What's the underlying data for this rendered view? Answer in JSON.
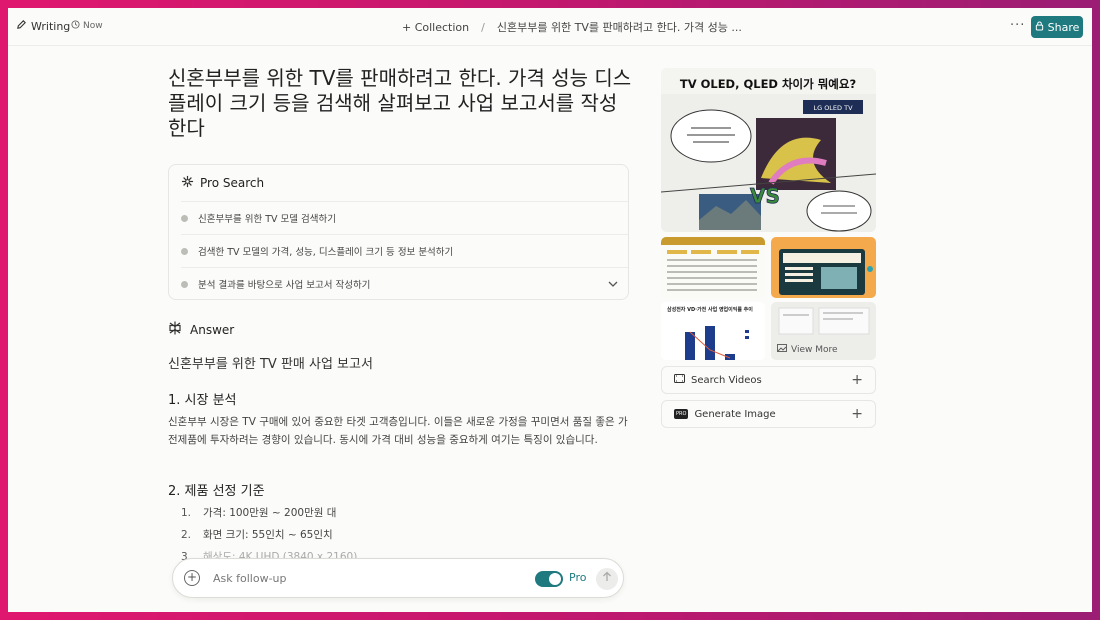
{
  "topbar": {
    "writing_label": "Writing",
    "time_label": "Now",
    "collection_label": "+ Collection",
    "breadcrumb_separator": "/",
    "thread_title": "신혼부부를 위한 TV를 판매하려고 한다. 가격 성능 ...",
    "more_label": "···",
    "share_label": "Share"
  },
  "main": {
    "title": "신혼부부를 위한 TV를 판매하려고 한다. 가격 성능 디스플레이 크기 등을 검색해 살펴보고 사업 보고서를 작성한다",
    "pro_search": {
      "label": "Pro Search",
      "steps": [
        "신혼부부를 위한 TV 모델 검색하기",
        "검색한 TV 모델의 가격, 성능, 디스플레이 크기 등 정보 분석하기",
        "분석 결과를 바탕으로 사업 보고서 작성하기"
      ]
    },
    "answer": {
      "label": "Answer",
      "report_title": "신혼부부를 위한 TV 판매 사업 보고서",
      "section1_heading": "1. 시장 분석",
      "section1_body": "신혼부부 시장은 TV 구매에 있어 중요한 타겟 고객층입니다. 이들은 새로운 가정을 꾸미면서 품질 좋은 가전제품에 투자하려는 경향이 있습니다. 동시에 가격 대비 성능을 중요하게 여기는 특징이 있습니다.",
      "section2_heading": "2. 제품 선정 기준",
      "criteria": [
        {
          "num": "1.",
          "text": "가격: 100만원 ~ 200만원 대"
        },
        {
          "num": "2.",
          "text": "화면 크기: 55인치 ~ 65인치"
        },
        {
          "num": "3.",
          "text": "해상도: 4K UHD (3840 x 2160)"
        }
      ]
    }
  },
  "followup": {
    "placeholder": "Ask follow-up",
    "pro_label": "Pro"
  },
  "sidebar": {
    "image_main_text": "TV OLED, QLED 차이가 뭐예요?",
    "image_main_badge": "LG OLED TV",
    "image_vs": "VS",
    "thumb3_title": "삼성전자 VD·가전 사업 영업이익률 추이",
    "view_more_label": "View More",
    "search_videos_label": "Search Videos",
    "generate_image_label": "Generate Image",
    "pro_badge": "PRO"
  },
  "colors": {
    "accent": "#1f7a80",
    "background": "#fbfbf9",
    "outer_gradient_start": "#e0176f",
    "outer_gradient_end": "#9b1d74"
  }
}
